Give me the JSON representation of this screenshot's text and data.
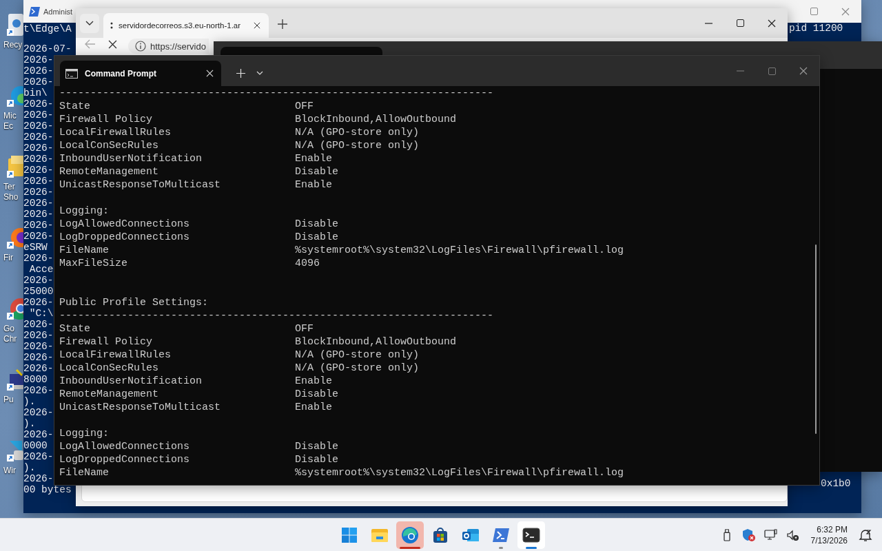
{
  "desktop_icons": [
    {
      "kind": "recycle",
      "label_lines": [
        "Recy"
      ]
    },
    {
      "kind": "edge",
      "label_lines": [
        "Mic",
        "Ec"
      ]
    },
    {
      "kind": "folder",
      "label_lines": [
        "Ter",
        "Sho"
      ]
    },
    {
      "kind": "firefox",
      "label_lines": [
        "Fir"
      ]
    },
    {
      "kind": "chrome",
      "label_lines": [
        "Go",
        "Chr"
      ]
    },
    {
      "kind": "putty",
      "label_lines": [
        "Pu"
      ]
    },
    {
      "kind": "winscp",
      "label_lines": [
        "Wir"
      ]
    }
  ],
  "powershell_window": {
    "title": "Administ",
    "top_line": "t\\Edge\\A",
    "log_lines": [
      "2026-07-",
      "2026-",
      "2026-",
      "2026-",
      "bin\\",
      "2026-",
      "2026-",
      "2026-",
      "2026-",
      "2026-",
      "2026-",
      "2026-",
      "2026-",
      "2026-",
      "2026-",
      "2026-",
      "2026-",
      "2026-",
      "eSRW",
      "2026-",
      " Acce",
      "2026-",
      "25000",
      "2026-",
      " \"C:\\",
      "2026-",
      "2026-",
      "2026-",
      "2026-",
      "2026-",
      "8000",
      "2026-",
      ").",
      "2026-",
      ").",
      "2026-",
      "0000",
      "2026-",
      ").",
      "2026-",
      "00 bytes"
    ],
    "right_lines": [
      "pid 11200",
      "0x1b0"
    ]
  },
  "browser_window": {
    "tab_title": "servidordecorreos.s3.eu-north-1.ar",
    "address": "https://servido"
  },
  "cmd_window": {
    "tab_title": "Command Prompt",
    "lines": [
      {
        "kind": "rule",
        "text": "----------------------------------------------------------------------"
      },
      {
        "kind": "pair",
        "label": "State",
        "value": "OFF"
      },
      {
        "kind": "pair",
        "label": "Firewall Policy",
        "value": "BlockInbound,AllowOutbound"
      },
      {
        "kind": "pair",
        "label": "LocalFirewallRules",
        "value": "N/A (GPO-store only)"
      },
      {
        "kind": "pair",
        "label": "LocalConSecRules",
        "value": "N/A (GPO-store only)"
      },
      {
        "kind": "pair",
        "label": "InboundUserNotification",
        "value": "Enable"
      },
      {
        "kind": "pair",
        "label": "RemoteManagement",
        "value": "Disable"
      },
      {
        "kind": "pair",
        "label": "UnicastResponseToMulticast",
        "value": "Enable"
      },
      {
        "kind": "blank"
      },
      {
        "kind": "heading",
        "text": "Logging:"
      },
      {
        "kind": "pair",
        "label": "LogAllowedConnections",
        "value": "Disable"
      },
      {
        "kind": "pair",
        "label": "LogDroppedConnections",
        "value": "Disable"
      },
      {
        "kind": "pair",
        "label": "FileName",
        "value": "%systemroot%\\system32\\LogFiles\\Firewall\\pfirewall.log"
      },
      {
        "kind": "pair",
        "label": "MaxFileSize",
        "value": "4096"
      },
      {
        "kind": "blank"
      },
      {
        "kind": "blank"
      },
      {
        "kind": "heading",
        "text": "Public Profile Settings:"
      },
      {
        "kind": "rule",
        "text": "----------------------------------------------------------------------"
      },
      {
        "kind": "pair",
        "label": "State",
        "value": "OFF"
      },
      {
        "kind": "pair",
        "label": "Firewall Policy",
        "value": "BlockInbound,AllowOutbound"
      },
      {
        "kind": "pair",
        "label": "LocalFirewallRules",
        "value": "N/A (GPO-store only)"
      },
      {
        "kind": "pair",
        "label": "LocalConSecRules",
        "value": "N/A (GPO-store only)"
      },
      {
        "kind": "pair",
        "label": "InboundUserNotification",
        "value": "Enable"
      },
      {
        "kind": "pair",
        "label": "RemoteManagement",
        "value": "Disable"
      },
      {
        "kind": "pair",
        "label": "UnicastResponseToMulticast",
        "value": "Enable"
      },
      {
        "kind": "blank"
      },
      {
        "kind": "heading",
        "text": "Logging:"
      },
      {
        "kind": "pair",
        "label": "LogAllowedConnections",
        "value": "Disable"
      },
      {
        "kind": "pair",
        "label": "LogDroppedConnections",
        "value": "Disable"
      },
      {
        "kind": "pair",
        "label": "FileName",
        "value": "%systemroot%\\system32\\LogFiles\\Firewall\\pfirewall.log"
      }
    ]
  },
  "taskbar": {
    "apps": [
      {
        "kind": "start",
        "running": false,
        "flashing": false,
        "selected": false
      },
      {
        "kind": "explorer",
        "running": false,
        "flashing": false,
        "selected": false
      },
      {
        "kind": "edge",
        "running": true,
        "flashing": true,
        "selected": false
      },
      {
        "kind": "store",
        "running": false,
        "flashing": false,
        "selected": false
      },
      {
        "kind": "outlook",
        "running": false,
        "flashing": false,
        "selected": false
      },
      {
        "kind": "powershell",
        "running": true,
        "flashing": false,
        "selected": false
      },
      {
        "kind": "terminal",
        "running": true,
        "flashing": false,
        "selected": true
      }
    ],
    "clock": {
      "time": "6:32 PM",
      "date": "7/13/2026"
    }
  }
}
